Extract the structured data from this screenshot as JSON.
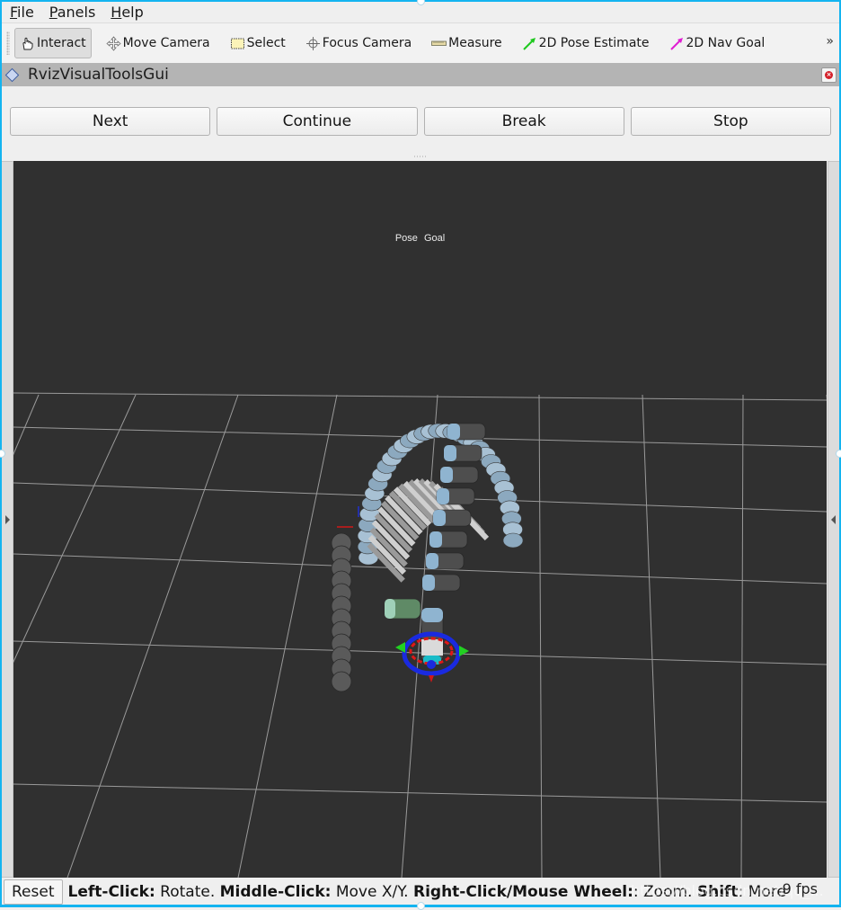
{
  "menubar": {
    "items": [
      {
        "label": "File",
        "mnemonic": "F",
        "rest": "ile"
      },
      {
        "label": "Panels",
        "mnemonic": "P",
        "rest": "anels"
      },
      {
        "label": "Help",
        "mnemonic": "H",
        "rest": "elp"
      }
    ]
  },
  "toolbar": {
    "tools": [
      {
        "label": "Interact",
        "icon": "hand-pointer-icon",
        "active": true
      },
      {
        "label": "Move Camera",
        "icon": "move-camera-icon",
        "active": false
      },
      {
        "label": "Select",
        "icon": "select-box-icon",
        "active": false
      },
      {
        "label": "Focus Camera",
        "icon": "focus-crosshair-icon",
        "active": false
      },
      {
        "label": "Measure",
        "icon": "ruler-icon",
        "active": false
      },
      {
        "label": "2D Pose Estimate",
        "icon": "green-arrow-icon",
        "active": false,
        "color": "#1ec81e"
      },
      {
        "label": "2D Nav Goal",
        "icon": "magenta-arrow-icon",
        "active": false,
        "color": "#e01ed2"
      }
    ],
    "overflow_label": "»"
  },
  "panel": {
    "title": "RvizVisualToolsGui",
    "close_label": "×",
    "buttons": [
      {
        "label": "Next"
      },
      {
        "label": "Continue"
      },
      {
        "label": "Break"
      },
      {
        "label": "Stop"
      }
    ]
  },
  "viewport": {
    "overlay_text": "Pose Goal",
    "background_color": "#303030",
    "grid_color": "#9a9a9a"
  },
  "statusbar": {
    "reset_label": "Reset",
    "segments": [
      {
        "bold": "Left-Click:",
        "text": " Rotate. "
      },
      {
        "bold": "Middle-Click:",
        "text": " Move X/Y. "
      },
      {
        "bold": "Right-Click/Mouse Wheel:",
        "text": ": Zoom. "
      },
      {
        "bold": "Shift",
        "text": ": More optior"
      }
    ],
    "fps": "9 fps",
    "watermark": "https://blog.csdn.net/qq_..."
  },
  "colors": {
    "window_border": "#14b4f0",
    "panel_title_bg": "#b4b4b4",
    "close_red": "#d4202a"
  }
}
